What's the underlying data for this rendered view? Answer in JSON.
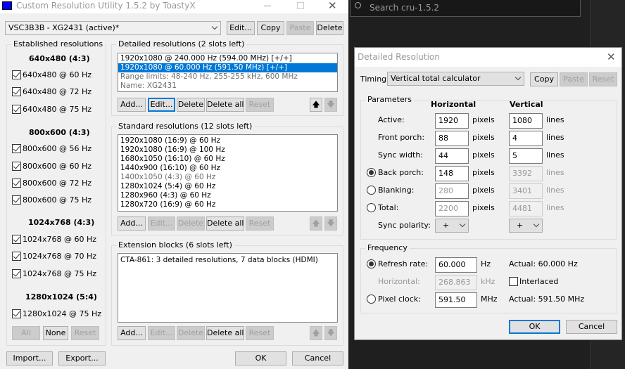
{
  "main": {
    "title": "Custom Resolution Utility 1.5.2 by ToastyX",
    "monitor": "VSC3B3B - XG2431 (active)*",
    "top_buttons": {
      "edit": "Edit...",
      "copy": "Copy",
      "paste": "Paste",
      "delete": "Delete"
    },
    "established": {
      "label": "Established resolutions",
      "groups": [
        {
          "header": "640x480 (4:3)",
          "items": [
            "640x480 @ 60 Hz",
            "640x480 @ 72 Hz",
            "640x480 @ 75 Hz"
          ]
        },
        {
          "header": "800x600 (4:3)",
          "items": [
            "800x600 @ 56 Hz",
            "800x600 @ 60 Hz",
            "800x600 @ 72 Hz",
            "800x600 @ 75 Hz"
          ]
        },
        {
          "header": "1024x768 (4:3)",
          "items": [
            "1024x768 @ 60 Hz",
            "1024x768 @ 70 Hz",
            "1024x768 @ 75 Hz"
          ]
        },
        {
          "header": "1280x1024 (5:4)",
          "items": [
            "1280x1024 @ 75 Hz"
          ]
        }
      ],
      "buttons": {
        "all": "All",
        "none": "None",
        "reset": "Reset"
      }
    },
    "detailed": {
      "label": "Detailed resolutions (2 slots left)",
      "items": [
        "1920x1080 @ 240.000 Hz (594.00 MHz) [+/+]",
        "1920x1080 @ 60.000 Hz (591.50 MHz) [+/+]",
        "Range limits: 48-240 Hz, 255-255 kHz, 600 MHz",
        "Name: XG2431"
      ]
    },
    "standard": {
      "label": "Standard resolutions (12 slots left)",
      "items": [
        "1920x1080 (16:9) @ 60 Hz",
        "1920x1080 (16:9) @ 100 Hz",
        "1680x1050 (16:10) @ 60 Hz",
        "1440x900 (16:10) @ 60 Hz",
        "1400x1050 (4:3) @ 60 Hz",
        "1280x1024 (5:4) @ 60 Hz",
        "1280x960 (4:3) @ 60 Hz",
        "1280x720 (16:9) @ 60 Hz"
      ]
    },
    "extension": {
      "label": "Extension blocks (6 slots left)",
      "items": [
        "CTA-861: 3 detailed resolutions, 7 data blocks (HDMI)"
      ]
    },
    "list_buttons": {
      "add": "Add...",
      "edit": "Edit...",
      "delete": "Delete",
      "delete_all": "Delete all",
      "reset": "Reset"
    },
    "bottom": {
      "import": "Import...",
      "export": "Export...",
      "ok": "OK",
      "cancel": "Cancel"
    }
  },
  "background": {
    "search_placeholder": "Search cru-1.5.2"
  },
  "dialog": {
    "title": "Detailed Resolution",
    "timing_label": "Timing:",
    "timing_value": "Vertical total calculator",
    "buttons": {
      "copy": "Copy",
      "paste": "Paste",
      "reset": "Reset",
      "ok": "OK",
      "cancel": "Cancel"
    },
    "parameters": {
      "label": "Parameters",
      "h_header": "Horizontal",
      "v_header": "Vertical",
      "h_unit": "pixels",
      "v_unit": "lines",
      "rows": [
        {
          "label": "Active:",
          "h": "1920",
          "v": "1080"
        },
        {
          "label": "Front porch:",
          "h": "88",
          "v": "4"
        },
        {
          "label": "Sync width:",
          "h": "44",
          "v": "5"
        },
        {
          "label": "Back porch:",
          "h": "148",
          "v": "3392",
          "selected": true
        },
        {
          "label": "Blanking:",
          "h": "280",
          "v": "3401"
        },
        {
          "label": "Total:",
          "h": "2200",
          "v": "4481"
        }
      ],
      "sync_polarity_label": "Sync polarity:",
      "h_polarity": "+",
      "v_polarity": "+"
    },
    "frequency": {
      "label": "Frequency",
      "refresh_label": "Refresh rate:",
      "refresh_value": "60.000",
      "refresh_unit": "Hz",
      "refresh_actual": "Actual: 60.000 Hz",
      "horizontal_label": "Horizontal:",
      "horizontal_value": "268.863",
      "horizontal_unit": "kHz",
      "interlaced_label": "Interlaced",
      "interlaced": false,
      "pixel_clock_label": "Pixel clock:",
      "pixel_clock_value": "591.50",
      "pixel_clock_unit": "MHz",
      "pixel_clock_actual": "Actual: 591.50 MHz",
      "selected": "refresh"
    }
  },
  "colors": {
    "accent": "#0078d7",
    "window": "#f0f0f0",
    "dark_bg": "#1f1f1f"
  }
}
